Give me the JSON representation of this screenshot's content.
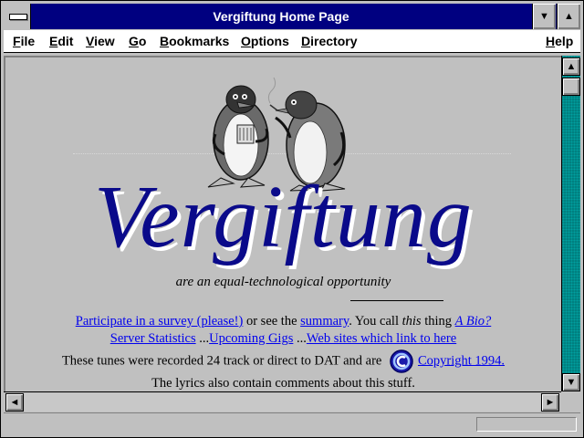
{
  "window": {
    "title": "Vergiftung Home Page"
  },
  "menu": {
    "items": [
      "File",
      "Edit",
      "View",
      "Go",
      "Bookmarks",
      "Options",
      "Directory"
    ],
    "help": "Help"
  },
  "page": {
    "heading": "Vergiftung",
    "tagline": "are an equal-technological opportunity",
    "line1": {
      "survey_link": "Participate in a survey (please!)",
      "text_a": " or see the ",
      "summary_link": "summary",
      "text_b": ".  You call ",
      "this_word": "this",
      "text_c": " thing ",
      "bio_link": "A Bio?"
    },
    "line2": {
      "stats_link": "Server Statistics",
      "sep1": " ...",
      "gigs_link": "Upcoming Gigs",
      "sep2": " ...",
      "websites_link": "Web sites which link to here"
    },
    "line3": {
      "text": "These tunes were recorded 24 track or direct to DAT and are ",
      "copyright_link": "Copyright 1994."
    },
    "line4": "The lyrics also contain comments about this stuff."
  },
  "icons": {
    "system_menu": "system-menu-icon",
    "minimize": "minimize-icon",
    "maximize": "maximize-icon",
    "scroll_up": "arrow-up-icon",
    "scroll_down": "arrow-down-icon",
    "scroll_left": "arrow-left-icon",
    "scroll_right": "arrow-right-icon",
    "copyright": "copyright-icon",
    "penguins": "penguins-illustration"
  },
  "colors": {
    "titlebar": "#000080",
    "heading": "#0a0a8a",
    "link": "#0000ee",
    "scroll_track": "#008080"
  }
}
